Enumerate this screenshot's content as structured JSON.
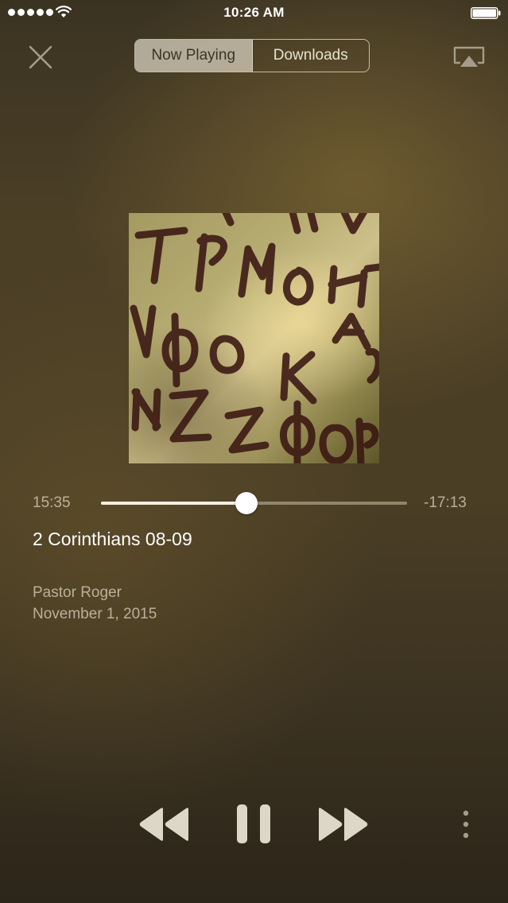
{
  "status_bar": {
    "time": "10:26 AM",
    "icons": [
      "signal-dots-icon",
      "wifi-icon",
      "battery-icon"
    ]
  },
  "header": {
    "close_icon": "close-icon",
    "tabs": [
      {
        "label": "Now Playing",
        "selected": true
      },
      {
        "label": "Downloads",
        "selected": false
      }
    ],
    "airplay_icon": "airplay-icon"
  },
  "player": {
    "elapsed": "15:35",
    "remaining": "-17:13",
    "progress": 0.475
  },
  "track": {
    "title": "2 Corinthians 08-09",
    "speaker": "Pastor Roger",
    "date": "November 1, 2015"
  },
  "controls": {
    "icons": [
      "rewind-icon",
      "pause-icon",
      "fast-forward-icon",
      "more-vertical-icon"
    ]
  },
  "colors": {
    "background": "#4a3e25",
    "text_primary": "#ffffff",
    "text_secondary": "#e1dac8",
    "accent": "#f4f0e6"
  }
}
